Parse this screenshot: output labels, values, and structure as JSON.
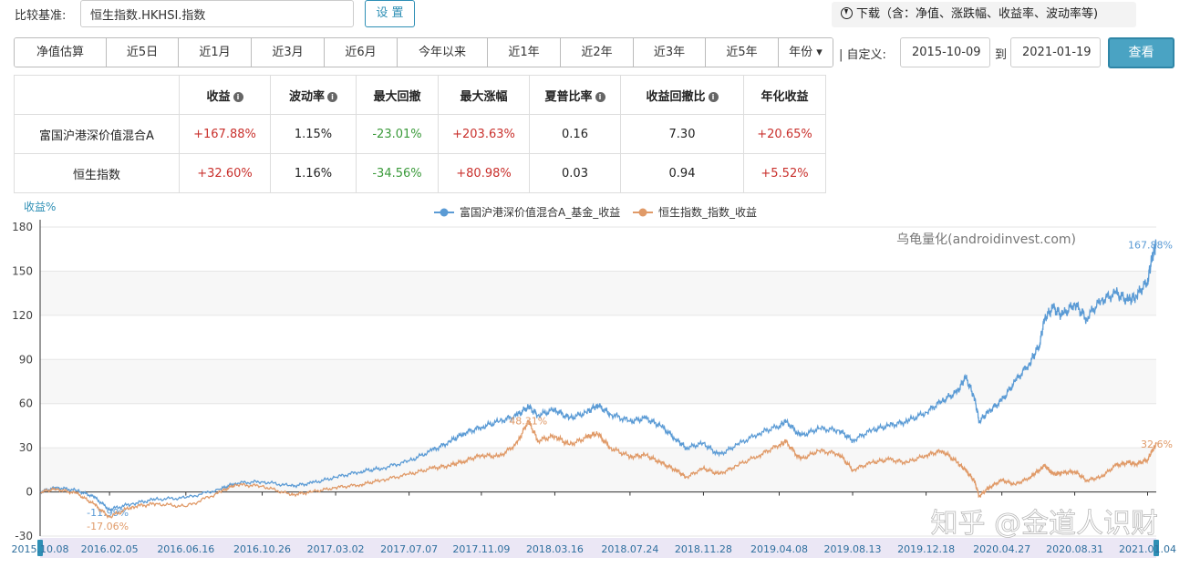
{
  "benchmark": {
    "label": "比较基准:",
    "value": "恒生指数.HKHSI.指数",
    "settings_label": "设 置"
  },
  "download": {
    "icon": "download-circle-icon",
    "label": "下载（含：净值、涨跌幅、收益率、波动率等)"
  },
  "periods": [
    "净值估算",
    "近5日",
    "近1月",
    "近3月",
    "近6月",
    "今年以来",
    "近1年",
    "近2年",
    "近3年",
    "近5年",
    "年份 ▾"
  ],
  "custom_range": {
    "label": "| 自定义:",
    "start": "2015-10-09",
    "to_label": "到",
    "end": "2021-01-19",
    "query_label": "查看"
  },
  "stats": {
    "headers": [
      "",
      "收益",
      "波动率",
      "最大回撤",
      "最大涨幅",
      "夏普比率",
      "收益回撤比",
      "年化收益"
    ],
    "header_info": [
      false,
      true,
      true,
      false,
      false,
      true,
      true,
      false
    ],
    "rows": [
      {
        "name": "富国沪港深价值混合A",
        "values": [
          "+167.88%",
          "1.15%",
          "-23.01%",
          "+203.63%",
          "0.16",
          "7.30",
          "+20.65%"
        ]
      },
      {
        "name": "恒生指数",
        "values": [
          "+32.60%",
          "1.16%",
          "-34.56%",
          "+80.98%",
          "0.03",
          "0.94",
          "+5.52%"
        ]
      }
    ]
  },
  "chart_data": {
    "type": "line",
    "ylabel": "收益%",
    "ylim": [
      -30,
      180
    ],
    "yticks": [
      -30,
      0,
      30,
      60,
      90,
      120,
      150,
      180
    ],
    "grid": true,
    "legend_position": "top-center",
    "watermark": "乌龟量化(androidinvest.com)",
    "overlay_watermark": "知乎 @金道人识财",
    "xticks": [
      "2015.10.08",
      "2016.02.05",
      "2016.06.16",
      "2016.10.26",
      "2017.03.02",
      "2017.07.07",
      "2017.11.09",
      "2018.03.16",
      "2018.07.24",
      "2018.11.28",
      "2019.04.08",
      "2019.08.13",
      "2019.12.18",
      "2020.04.27",
      "2020.08.31",
      "2021.01.04"
    ],
    "x_domain": [
      "2015.10.08",
      "2021.01.19"
    ],
    "series": [
      {
        "name": "富国沪港深价值混合A_基金_收益",
        "color": "#5b9bd5",
        "end_label": "167.88%",
        "min_label": "-11.99%",
        "points": [
          [
            "2015.10.08",
            0
          ],
          [
            "2015.11.05",
            3
          ],
          [
            "2015.12.10",
            1
          ],
          [
            "2016.01.08",
            -3
          ],
          [
            "2016.02.05",
            -11.99
          ],
          [
            "2016.03.15",
            -8
          ],
          [
            "2016.04.25",
            -5
          ],
          [
            "2016.06.16",
            -4
          ],
          [
            "2016.08.15",
            2
          ],
          [
            "2016.09.10",
            6
          ],
          [
            "2016.10.26",
            7
          ],
          [
            "2016.12.15",
            4
          ],
          [
            "2017.01.20",
            6
          ],
          [
            "2017.03.02",
            10
          ],
          [
            "2017.04.15",
            14
          ],
          [
            "2017.05.20",
            16
          ],
          [
            "2017.07.07",
            21
          ],
          [
            "2017.08.15",
            28
          ],
          [
            "2017.09.15",
            34
          ],
          [
            "2017.10.10",
            40
          ],
          [
            "2017.11.09",
            44
          ],
          [
            "2017.12.10",
            48
          ],
          [
            "2018.01.10",
            52
          ],
          [
            "2018.01.29",
            58
          ],
          [
            "2018.02.15",
            52
          ],
          [
            "2018.03.16",
            56
          ],
          [
            "2018.04.10",
            50
          ],
          [
            "2018.05.10",
            54
          ],
          [
            "2018.05.28",
            59
          ],
          [
            "2018.06.20",
            53
          ],
          [
            "2018.07.24",
            48
          ],
          [
            "2018.08.20",
            50
          ],
          [
            "2018.09.15",
            45
          ],
          [
            "2018.10.11",
            36
          ],
          [
            "2018.10.29",
            30
          ],
          [
            "2018.11.28",
            33
          ],
          [
            "2018.12.25",
            25
          ],
          [
            "2019.01.25",
            32
          ],
          [
            "2019.03.05",
            40
          ],
          [
            "2019.04.08",
            45
          ],
          [
            "2019.04.20",
            48
          ],
          [
            "2019.05.15",
            38
          ],
          [
            "2019.06.15",
            43
          ],
          [
            "2019.07.20",
            42
          ],
          [
            "2019.08.13",
            35
          ],
          [
            "2019.09.15",
            42
          ],
          [
            "2019.10.15",
            45
          ],
          [
            "2019.11.15",
            48
          ],
          [
            "2019.12.18",
            54
          ],
          [
            "2020.01.15",
            62
          ],
          [
            "2020.02.10",
            68
          ],
          [
            "2020.02.24",
            78
          ],
          [
            "2020.03.10",
            65
          ],
          [
            "2020.03.19",
            48
          ],
          [
            "2020.04.05",
            55
          ],
          [
            "2020.04.27",
            62
          ],
          [
            "2020.05.20",
            75
          ],
          [
            "2020.06.15",
            88
          ],
          [
            "2020.07.01",
            100
          ],
          [
            "2020.07.10",
            118
          ],
          [
            "2020.07.25",
            125
          ],
          [
            "2020.08.10",
            120
          ],
          [
            "2020.08.31",
            128
          ],
          [
            "2020.09.20",
            118
          ],
          [
            "2020.10.15",
            130
          ],
          [
            "2020.11.10",
            135
          ],
          [
            "2020.12.01",
            130
          ],
          [
            "2020.12.15",
            133
          ],
          [
            "2021.01.04",
            143
          ],
          [
            "2021.01.12",
            160
          ],
          [
            "2021.01.19",
            167.88
          ]
        ]
      },
      {
        "name": "恒生指数_指数_收益",
        "color": "#e09a68",
        "end_label": "32.6%",
        "min_label": "-17.06%",
        "max_label": "48.31%",
        "points": [
          [
            "2015.10.08",
            0
          ],
          [
            "2015.11.05",
            2
          ],
          [
            "2015.12.10",
            -1
          ],
          [
            "2016.01.08",
            -8
          ],
          [
            "2016.02.05",
            -17.06
          ],
          [
            "2016.03.15",
            -10
          ],
          [
            "2016.04.25",
            -8
          ],
          [
            "2016.06.16",
            -10
          ],
          [
            "2016.08.15",
            0
          ],
          [
            "2016.09.10",
            5
          ],
          [
            "2016.10.26",
            4
          ],
          [
            "2016.12.15",
            -2
          ],
          [
            "2017.01.20",
            0
          ],
          [
            "2017.03.02",
            3
          ],
          [
            "2017.04.15",
            5
          ],
          [
            "2017.05.20",
            8
          ],
          [
            "2017.07.07",
            12
          ],
          [
            "2017.08.15",
            16
          ],
          [
            "2017.09.15",
            18
          ],
          [
            "2017.10.10",
            21
          ],
          [
            "2017.11.09",
            25
          ],
          [
            "2017.12.10",
            24
          ],
          [
            "2018.01.10",
            33
          ],
          [
            "2018.01.29",
            48.31
          ],
          [
            "2018.02.15",
            35
          ],
          [
            "2018.03.16",
            38
          ],
          [
            "2018.04.10",
            32
          ],
          [
            "2018.05.10",
            37
          ],
          [
            "2018.05.28",
            40
          ],
          [
            "2018.06.20",
            30
          ],
          [
            "2018.07.24",
            24
          ],
          [
            "2018.08.20",
            25
          ],
          [
            "2018.09.15",
            20
          ],
          [
            "2018.10.11",
            15
          ],
          [
            "2018.10.29",
            10
          ],
          [
            "2018.11.28",
            16
          ],
          [
            "2018.12.25",
            12
          ],
          [
            "2019.01.25",
            18
          ],
          [
            "2019.03.05",
            25
          ],
          [
            "2019.04.08",
            32
          ],
          [
            "2019.04.20",
            34
          ],
          [
            "2019.05.15",
            22
          ],
          [
            "2019.06.15",
            28
          ],
          [
            "2019.07.20",
            26
          ],
          [
            "2019.08.13",
            15
          ],
          [
            "2019.09.15",
            20
          ],
          [
            "2019.10.15",
            22
          ],
          [
            "2019.11.15",
            20
          ],
          [
            "2019.12.18",
            25
          ],
          [
            "2020.01.15",
            28
          ],
          [
            "2020.02.10",
            20
          ],
          [
            "2020.02.24",
            15
          ],
          [
            "2020.03.10",
            8
          ],
          [
            "2020.03.19",
            -3
          ],
          [
            "2020.04.05",
            3
          ],
          [
            "2020.04.27",
            8
          ],
          [
            "2020.05.20",
            5
          ],
          [
            "2020.06.15",
            10
          ],
          [
            "2020.07.01",
            15
          ],
          [
            "2020.07.10",
            18
          ],
          [
            "2020.07.25",
            12
          ],
          [
            "2020.08.10",
            13
          ],
          [
            "2020.08.31",
            14
          ],
          [
            "2020.09.20",
            8
          ],
          [
            "2020.10.15",
            10
          ],
          [
            "2020.11.10",
            18
          ],
          [
            "2020.12.01",
            20
          ],
          [
            "2020.12.15",
            19
          ],
          [
            "2021.01.04",
            22
          ],
          [
            "2021.01.12",
            28
          ],
          [
            "2021.01.19",
            32.6
          ]
        ]
      }
    ]
  }
}
